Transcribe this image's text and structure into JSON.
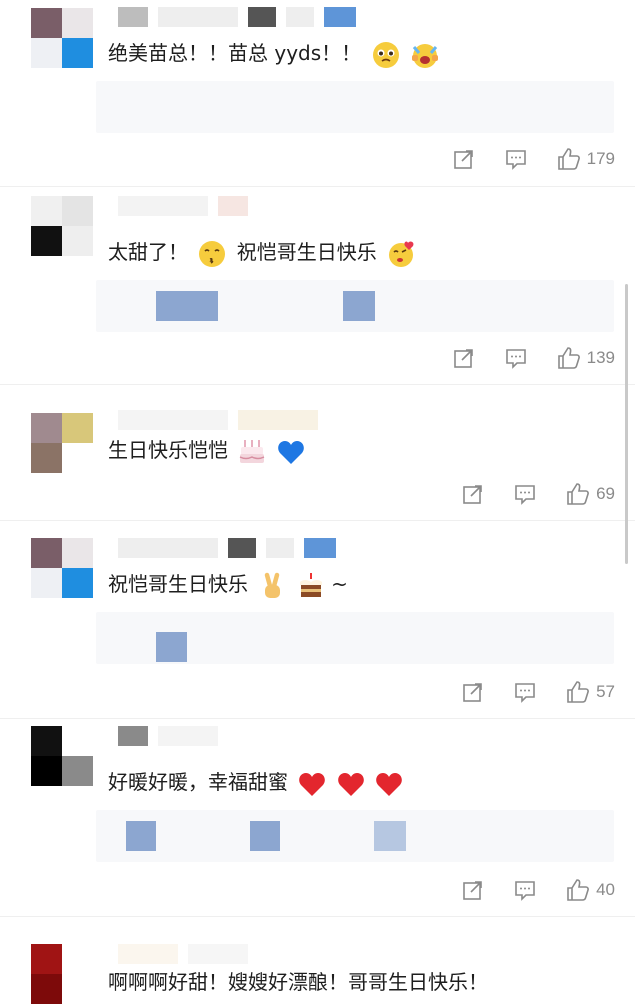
{
  "comments": [
    {
      "avatar": [
        "#7a5e68",
        "#eae6e8",
        "#eef0f4",
        "#1f8ee0"
      ],
      "text": "绝美苗总！！苗总 yyds！！",
      "emojis": [
        "pleading-face-emoji",
        "crying-joy-face-emoji"
      ],
      "likes": "179"
    },
    {
      "avatar": [
        "#f0f0f0",
        "#ededed",
        "#111111",
        "#eeeeee"
      ],
      "text": "太甜了！",
      "text2": "祝恺哥生日快乐",
      "emojis": [
        "kissing-face-emoji",
        "kissing-heart-face-emoji"
      ],
      "likes": "139"
    },
    {
      "avatar": [
        "#a08a8f",
        "#d8c77a",
        "#8b7366",
        "#ffffff"
      ],
      "text": "生日快乐恺恺",
      "emojis": [
        "birthday-cake-emoji",
        "blue-heart-emoji"
      ],
      "likes": "69"
    },
    {
      "avatar": [
        "#7a5e68",
        "#eae6e8",
        "#eef0f4",
        "#1f8ee0"
      ],
      "text": "祝恺哥生日快乐",
      "emojis": [
        "victory-hand-emoji",
        "birthday-cake-emoji"
      ],
      "suffix": "~",
      "likes": "57"
    },
    {
      "avatar": [
        "#111111",
        "#ffffff",
        "#000000",
        "#8a8a8a"
      ],
      "text": "好暖好暖，幸福甜蜜",
      "emojis": [
        "red-heart-emoji",
        "red-heart-emoji",
        "red-heart-emoji"
      ],
      "likes": "40"
    },
    {
      "avatar": [
        "#a01414",
        "#ffffff",
        "#7d0a0a",
        "#ffffff"
      ],
      "text": "啊啊啊好甜！嫂嫂好漂酿！哥哥生日快乐！"
    }
  ],
  "colors": {
    "icon": "#8a8a8a",
    "reply_bg": "#f7f8fa",
    "blur": "#7f9ccb"
  }
}
